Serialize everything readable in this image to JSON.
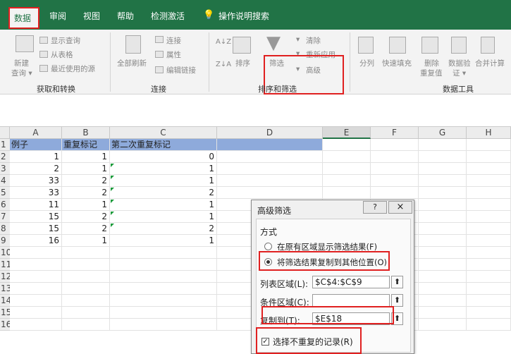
{
  "menu": {
    "tabs": [
      "数据",
      "审阅",
      "视图",
      "帮助",
      "检测激活"
    ],
    "search": "操作说明搜索"
  },
  "ribbon": {
    "group1": {
      "new_query": "新建",
      "new_query2": "查询 ▾",
      "show_query": "显示查询",
      "from_table": "从表格",
      "recent": "最近使用的源",
      "label": "获取和转换"
    },
    "group2": {
      "refresh_all": "全部刷新",
      "connections": "连接",
      "properties": "属性",
      "edit_links": "编辑链接",
      "label": "连接"
    },
    "group3": {
      "sort": "排序",
      "filter": "筛选",
      "clear": "清除",
      "reapply": "重新应用",
      "advanced": "高级",
      "label": "排序和筛选"
    },
    "group4": {
      "split": "分列",
      "flash_fill": "快速填充",
      "remove_dup": "删除",
      "remove_dup2": "重复值",
      "validate": "数据验",
      "validate2": "证 ▾",
      "consolidate": "合并计算",
      "label": "数据工具"
    }
  },
  "columns": [
    "A",
    "B",
    "C",
    "D",
    "E",
    "F",
    "G",
    "H"
  ],
  "rows": [
    "1",
    "2",
    "3",
    "4",
    "5",
    "6",
    "7",
    "8",
    "9",
    "10",
    "11",
    "12",
    "13",
    "14",
    "15",
    "16"
  ],
  "sheet": {
    "headers": [
      "例子",
      "重复标记",
      "第二次重复标记"
    ],
    "data": [
      [
        "1",
        "1",
        "0"
      ],
      [
        "2",
        "1",
        "1"
      ],
      [
        "33",
        "2",
        "1"
      ],
      [
        "33",
        "2",
        "2"
      ],
      [
        "11",
        "1",
        "1"
      ],
      [
        "15",
        "2",
        "1"
      ],
      [
        "15",
        "2",
        "2"
      ],
      [
        "16",
        "1",
        "1"
      ]
    ]
  },
  "dialog": {
    "title": "高级筛选",
    "help": "?",
    "close": "×",
    "mode_label": "方式",
    "option1": "在原有区域显示筛选结果(F)",
    "option2": "将筛选结果复制到其他位置(O)",
    "list_range_label": "列表区域(L):",
    "list_range": "$C$4:$C$9",
    "criteria_label": "条件区域(C):",
    "criteria": "",
    "copy_to_label": "复制到(T):",
    "copy_to": "$E$18",
    "unique_label": "选择不重复的记录(R)",
    "pick_icon": "⬆"
  }
}
